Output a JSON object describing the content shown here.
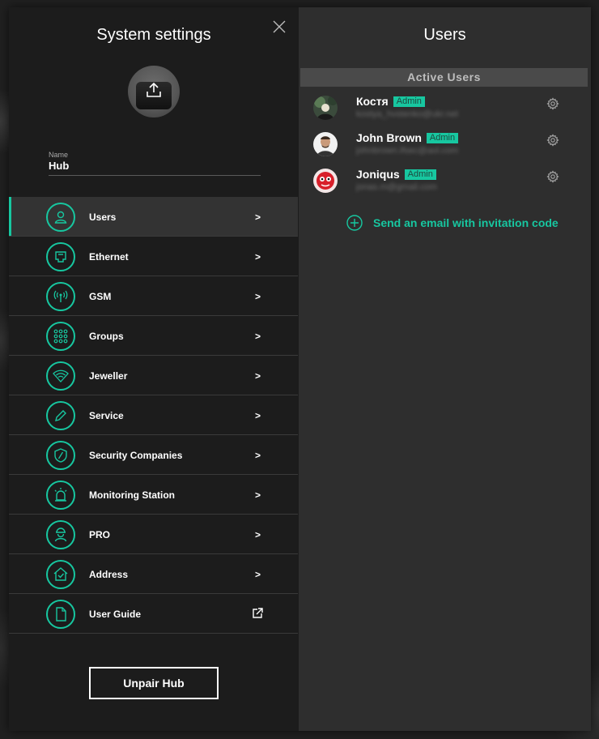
{
  "left": {
    "title": "System settings",
    "name_label": "Name",
    "name_value": "Hub",
    "menu": [
      {
        "label": "Users",
        "icon": "user-icon",
        "trailing": ">",
        "active": true
      },
      {
        "label": "Ethernet",
        "icon": "ethernet-icon",
        "trailing": ">"
      },
      {
        "label": "GSM",
        "icon": "antenna-icon",
        "trailing": ">"
      },
      {
        "label": "Groups",
        "icon": "grid-icon",
        "trailing": ">"
      },
      {
        "label": "Jeweller",
        "icon": "wireless-icon",
        "trailing": ">"
      },
      {
        "label": "Service",
        "icon": "pencil-icon",
        "trailing": ">"
      },
      {
        "label": "Security Companies",
        "icon": "shield-icon",
        "trailing": ">"
      },
      {
        "label": "Monitoring Station",
        "icon": "siren-icon",
        "trailing": ">"
      },
      {
        "label": "PRO",
        "icon": "installer-icon",
        "trailing": ">"
      },
      {
        "label": "Address",
        "icon": "house-icon",
        "trailing": ">"
      },
      {
        "label": "User Guide",
        "icon": "document-icon",
        "trailing": "external-link-icon"
      }
    ],
    "unpair_label": "Unpair Hub"
  },
  "right": {
    "title": "Users",
    "section_header": "Active Users",
    "users": [
      {
        "name": "Костя",
        "badge": "Admin",
        "email": "kostya_hvstenko@ukr.net"
      },
      {
        "name": "John Brown",
        "badge": "Admin",
        "email": "johnbrown.ifsec@aol.com"
      },
      {
        "name": "Joniqus",
        "badge": "Admin",
        "email": "jonas.m@gmail.com"
      }
    ],
    "invite_label": "Send an email with invitation code"
  },
  "colors": {
    "accent": "#17c7a0",
    "left_bg": "#1c1c1c",
    "right_bg": "#2e2e2e",
    "active_item_bg": "#333333"
  }
}
